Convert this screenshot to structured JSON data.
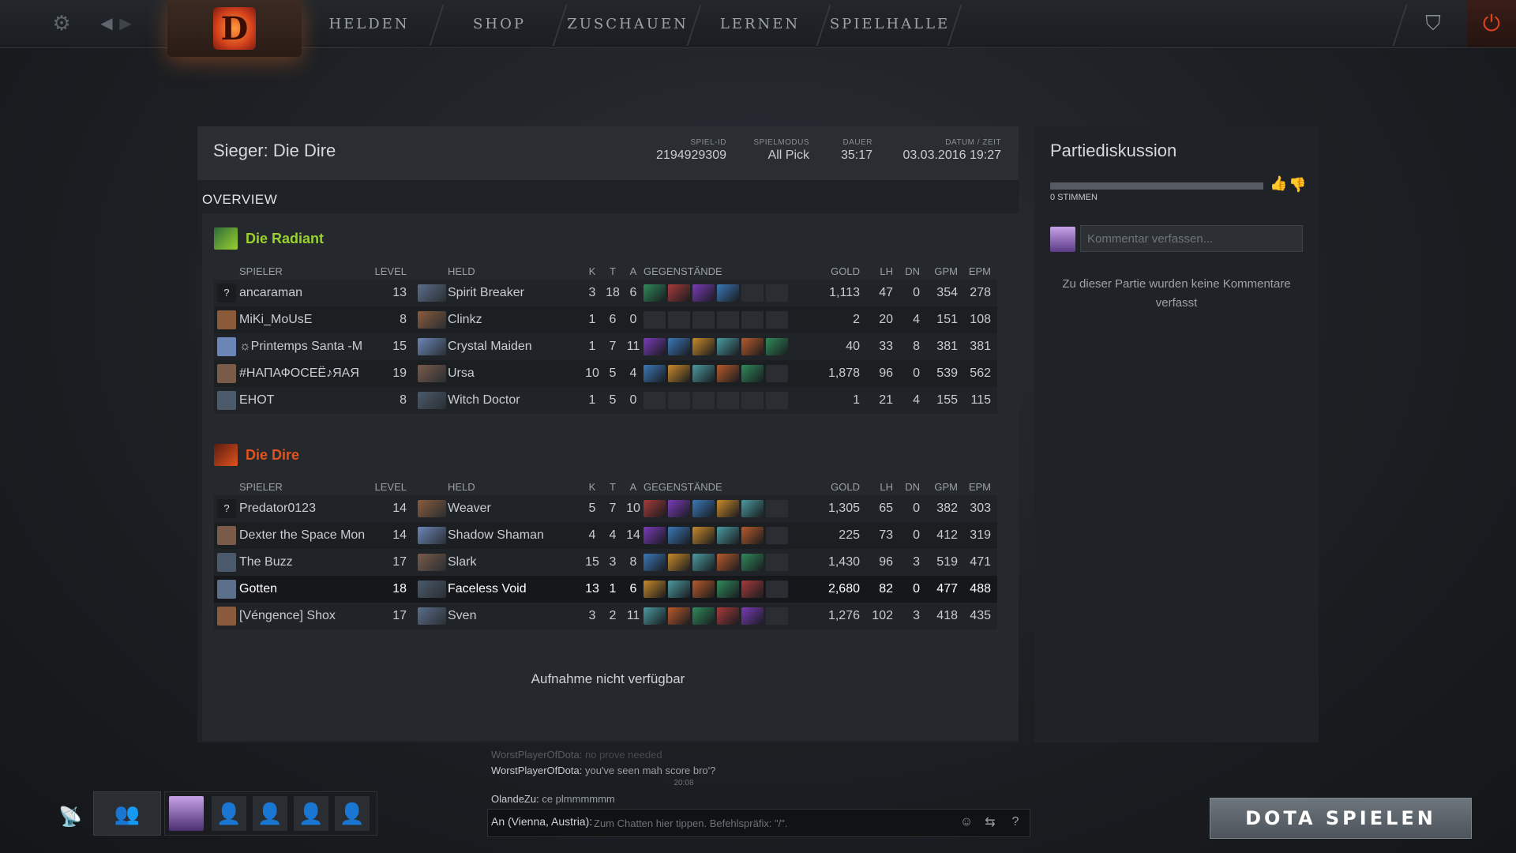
{
  "nav": {
    "items": [
      "HELDEN",
      "SHOP",
      "ZUSCHAUEN",
      "LERNEN",
      "SPIELHALLE"
    ]
  },
  "match": {
    "title": "Sieger: Die Dire",
    "meta": [
      {
        "label": "SPIEL-ID",
        "value": "2194929309"
      },
      {
        "label": "SPIELMODUS",
        "value": "All Pick"
      },
      {
        "label": "DAUER",
        "value": "35:17"
      },
      {
        "label": "DATUM / ZEIT",
        "value": "03.03.2016 19:27"
      }
    ],
    "section": "OVERVIEW",
    "replay_text": "Aufnahme nicht verfügbar"
  },
  "columns": [
    "SPIELER",
    "LEVEL",
    "HELD",
    "K",
    "T",
    "A",
    "GEGENSTÄNDE",
    "GOLD",
    "LH",
    "DN",
    "GPM",
    "EPM"
  ],
  "teams": [
    {
      "name": "Die Radiant",
      "color": "#9ad12e",
      "players": [
        {
          "player": "ancaraman",
          "avatar": "?",
          "level": "13",
          "hero": "Spirit Breaker",
          "k": "3",
          "t": "18",
          "a": "6",
          "gold": "1,113",
          "lh": "47",
          "dn": "0",
          "gpm": "354",
          "epm": "278",
          "items": 4
        },
        {
          "player": "MiKi_MoUsE",
          "avatar": "",
          "level": "8",
          "hero": "Clinkz",
          "k": "1",
          "t": "6",
          "a": "0",
          "gold": "2",
          "lh": "20",
          "dn": "4",
          "gpm": "151",
          "epm": "108",
          "items": 0
        },
        {
          "player": "☼Printemps Santa -M",
          "avatar": "",
          "level": "15",
          "hero": "Crystal Maiden",
          "k": "1",
          "t": "7",
          "a": "11",
          "gold": "40",
          "lh": "33",
          "dn": "8",
          "gpm": "381",
          "epm": "381",
          "items": 6
        },
        {
          "player": "#НАПАФОСЕЁ♪ЯAЯ",
          "avatar": "",
          "level": "19",
          "hero": "Ursa",
          "k": "10",
          "t": "5",
          "a": "4",
          "gold": "1,878",
          "lh": "96",
          "dn": "0",
          "gpm": "539",
          "epm": "562",
          "items": 5
        },
        {
          "player": "EHOT",
          "avatar": "",
          "level": "8",
          "hero": "Witch Doctor",
          "k": "1",
          "t": "5",
          "a": "0",
          "gold": "1",
          "lh": "21",
          "dn": "4",
          "gpm": "155",
          "epm": "115",
          "items": 0
        }
      ]
    },
    {
      "name": "Die Dire",
      "color": "#e0531e",
      "players": [
        {
          "player": "Predator0123",
          "avatar": "?",
          "level": "14",
          "hero": "Weaver",
          "k": "5",
          "t": "7",
          "a": "10",
          "gold": "1,305",
          "lh": "65",
          "dn": "0",
          "gpm": "382",
          "epm": "303",
          "items": 5
        },
        {
          "player": "Dexter the Space Mon",
          "avatar": "",
          "level": "14",
          "hero": "Shadow Shaman",
          "k": "4",
          "t": "4",
          "a": "14",
          "gold": "225",
          "lh": "73",
          "dn": "0",
          "gpm": "412",
          "epm": "319",
          "items": 5
        },
        {
          "player": "The Buzz",
          "avatar": "",
          "level": "17",
          "hero": "Slark",
          "k": "15",
          "t": "3",
          "a": "8",
          "gold": "1,430",
          "lh": "96",
          "dn": "3",
          "gpm": "519",
          "epm": "471",
          "items": 5
        },
        {
          "player": "Gotten",
          "avatar": "",
          "level": "18",
          "hero": "Faceless Void",
          "k": "13",
          "t": "1",
          "a": "6",
          "gold": "2,680",
          "lh": "82",
          "dn": "0",
          "gpm": "477",
          "epm": "488",
          "items": 5
        },
        {
          "player": "[Véngence] Shox",
          "avatar": "",
          "level": "17",
          "hero": "Sven",
          "k": "3",
          "t": "2",
          "a": "11",
          "gold": "1,276",
          "lh": "102",
          "dn": "3",
          "gpm": "418",
          "epm": "435",
          "items": 5
        }
      ]
    }
  ],
  "discussion": {
    "title": "Partiediskussion",
    "votes": "0 STIMMEN",
    "comment_placeholder": "Kommentar verfassen...",
    "empty_text": "Zu dieser Partie wurden keine Kommentare verfasst"
  },
  "chat": {
    "lines": [
      {
        "who": "WorstPlayerOfDota:",
        "text": "no prove needed",
        "faded": true
      },
      {
        "who": "WorstPlayerOfDota:",
        "text": "you've seen mah score bro'?",
        "faded": false
      },
      {
        "who": "OlandeZu:",
        "text": "ce plmmmmmm",
        "faded": false
      }
    ],
    "time_marker": "20:08",
    "prefix": "An (Vienna, Austria):",
    "placeholder": "Zum Chatten hier tippen. Befehlspräfix: \"/\"."
  },
  "play_button": "DOTA SPIELEN"
}
